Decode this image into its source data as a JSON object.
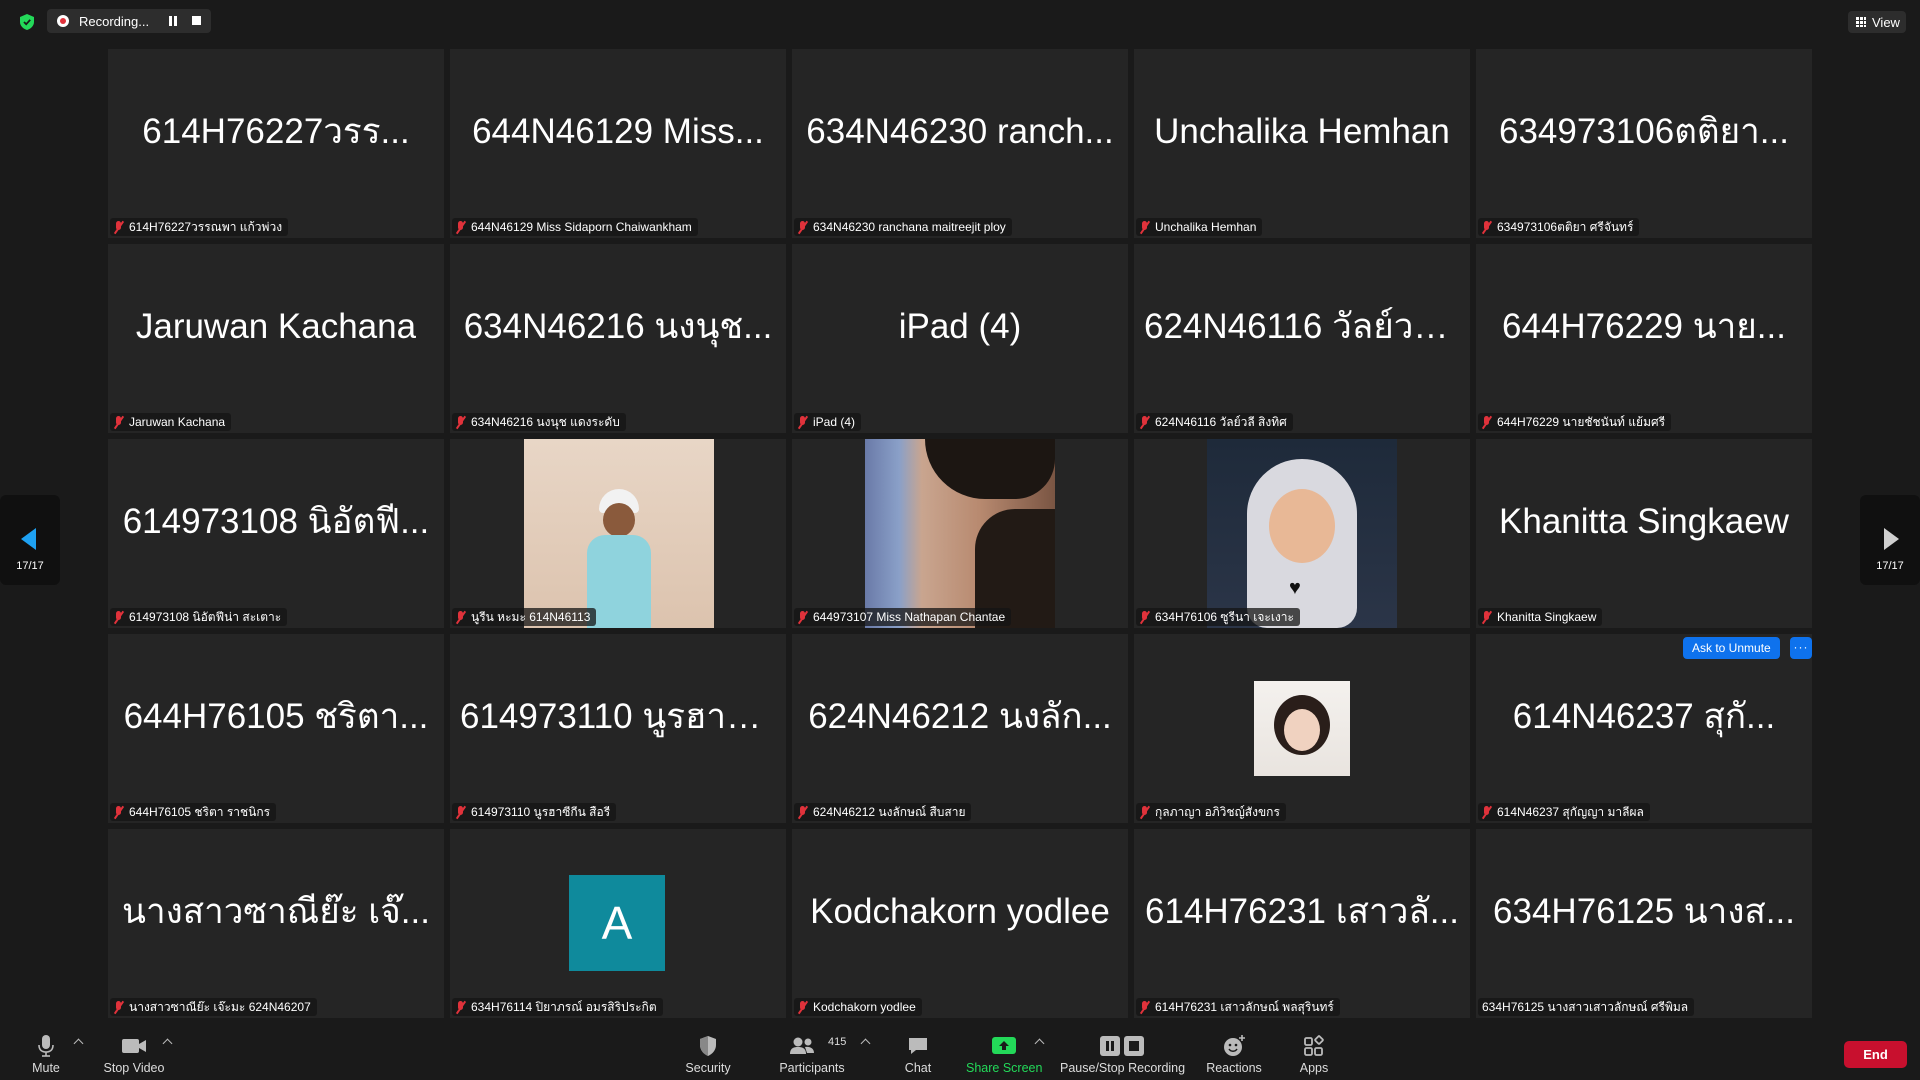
{
  "topbar": {
    "recording_label": "Recording...",
    "view_label": "View"
  },
  "pagination": {
    "left_count": "17/17",
    "right_count": "17/17"
  },
  "tiles": [
    {
      "big": "614H76227วรร...",
      "name": "614H76227วรรณพา แก้วพ่วง",
      "type": "name"
    },
    {
      "big": "644N46129 Miss...",
      "name": "644N46129 Miss Sidaporn Chaiwankham",
      "type": "name"
    },
    {
      "big": "634N46230 ranch...",
      "name": "634N46230 ranchana maitreejit ploy",
      "type": "name"
    },
    {
      "big": "Unchalika Hemhan",
      "name": "Unchalika Hemhan",
      "type": "name"
    },
    {
      "big": "634973106ตติยา...",
      "name": "634973106ตติยา ศรีจันทร์",
      "type": "name"
    },
    {
      "big": "Jaruwan Kachana",
      "name": "Jaruwan Kachana",
      "type": "name"
    },
    {
      "big": "634N46216 นงนุช...",
      "name": "634N46216 นงนุช แดงระดับ",
      "type": "name"
    },
    {
      "big": "iPad (4)",
      "name": "iPad (4)",
      "type": "name"
    },
    {
      "big": "624N46116 วัลย์วลี...",
      "name": "624N46116 วัลย์วลี สิงทิศ",
      "type": "name"
    },
    {
      "big": "644H76229 นาย...",
      "name": "644H76229 นายชัชนันท์ แย้มศรี",
      "type": "name"
    },
    {
      "big": "614973108 นิอัตฟี...",
      "name": "614973108 นิอัตฟีน่า สะเตาะ",
      "type": "name"
    },
    {
      "big": "",
      "name": "นูรีน หะมะ 614N46113",
      "type": "video1"
    },
    {
      "big": "",
      "name": "644973107 Miss Nathapan Chantae",
      "type": "video2"
    },
    {
      "big": "",
      "name": "634H76106 ซูรีนา เจะเงาะ",
      "type": "video3"
    },
    {
      "big": "Khanitta Singkaew",
      "name": "Khanitta Singkaew",
      "type": "name"
    },
    {
      "big": "644H76105 ชริตา...",
      "name": "644H76105 ชริตา ราชนิกร",
      "type": "name"
    },
    {
      "big": "614973110 นูรฮาซี...",
      "name": "614973110 นูรฮาซีกีน สือรี",
      "type": "name"
    },
    {
      "big": "624N46212 นงลัก...",
      "name": "624N46212 นงลักษณ์ สืบสาย",
      "type": "name"
    },
    {
      "big": "",
      "name": "กุลภาญา อภิวิชญ์สังขกร",
      "type": "photo"
    },
    {
      "big": "614N46237 สุกั...",
      "name": "614N46237 สุกัญญา มาลีผล",
      "type": "name",
      "ask_unmute": "Ask to Unmute",
      "more": "···"
    },
    {
      "big": "นางสาวซาณีย๊ะ เจ๊...",
      "name": "นางสาวซาณีย๊ะ เจ๊ะมะ 624N46207",
      "type": "name"
    },
    {
      "big": "",
      "name": "634H76114 ปิยาภรณ์ อมรสิริประกิต",
      "type": "avatar",
      "avatar_letter": "A"
    },
    {
      "big": "Kodchakorn yodlee",
      "name": "Kodchakorn yodlee",
      "type": "name"
    },
    {
      "big": "614H76231 เสาวลั...",
      "name": "614H76231 เสาวลักษณ์ พลสุรินทร์",
      "type": "name"
    },
    {
      "big": "634H76125 นางส...",
      "name": "634H76125 นางสาวเสาวลักษณ์ ศรีพิมล",
      "type": "name",
      "no_mic": true
    }
  ],
  "toolbar": {
    "mute": "Mute",
    "stop_video": "Stop Video",
    "security": "Security",
    "participants": "Participants",
    "participants_count": "415",
    "chat": "Chat",
    "share_screen": "Share Screen",
    "pause_stop_recording": "Pause/Stop Recording",
    "reactions": "Reactions",
    "apps": "Apps",
    "end": "End"
  },
  "colors": {
    "accent_blue": "#0e72ed",
    "share_green": "#23d959",
    "end_red": "#c8102e",
    "muted_red": "#e0323b",
    "nav_blue": "#1ea1f2",
    "avatar_teal": "#0f8a9c"
  }
}
